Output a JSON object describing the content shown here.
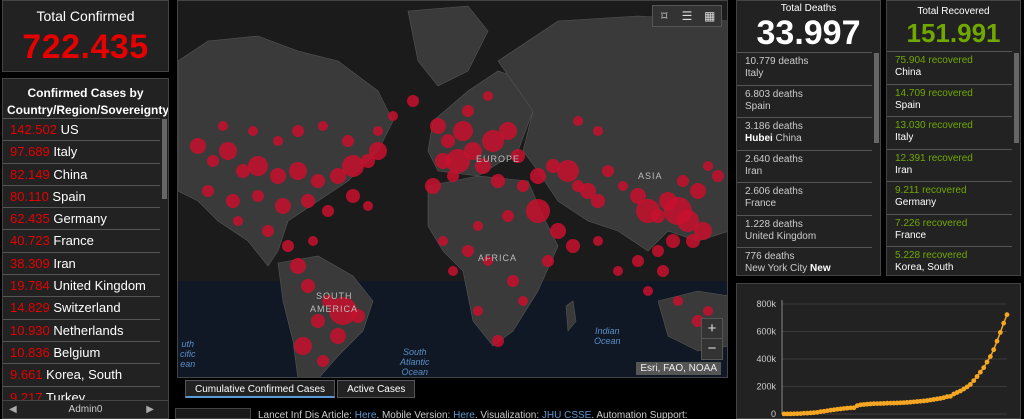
{
  "total_confirmed": {
    "title": "Total Confirmed",
    "value": "722.435"
  },
  "country_list": {
    "header": "Confirmed Cases by Country/Region/Sovereignty",
    "items": [
      {
        "value": "142.502",
        "name": "US"
      },
      {
        "value": "97.689",
        "name": "Italy"
      },
      {
        "value": "82.149",
        "name": "China"
      },
      {
        "value": "80.110",
        "name": "Spain"
      },
      {
        "value": "62.435",
        "name": "Germany"
      },
      {
        "value": "40.723",
        "name": "France"
      },
      {
        "value": "38.309",
        "name": "Iran"
      },
      {
        "value": "19.784",
        "name": "United Kingdom"
      },
      {
        "value": "14.829",
        "name": "Switzerland"
      },
      {
        "value": "10.930",
        "name": "Netherlands"
      },
      {
        "value": "10.836",
        "name": "Belgium"
      },
      {
        "value": "9.661",
        "name": "Korea, South"
      },
      {
        "value": "9.217",
        "name": "Turkey"
      }
    ],
    "footer": "Admin0"
  },
  "map": {
    "labels": {
      "europe": "EUROPE",
      "asia": "ASIA",
      "africa": "AFRICA",
      "south_america_1": "SOUTH",
      "south_america_2": "AMERICA"
    },
    "oceans": {
      "south_pacific_1": "uth",
      "south_pacific_2": "cific",
      "south_pacific_3": "ean",
      "south_atlantic_1": "South",
      "south_atlantic_2": "Atlantic",
      "south_atlantic_3": "Ocean",
      "indian_1": "Indian",
      "indian_2": "Ocean"
    },
    "attribution": "Esri, FAO, NOAA",
    "zoom_in": "+",
    "zoom_out": "−",
    "icons": [
      "bookmark-icon",
      "list-icon",
      "qr-code-icon"
    ]
  },
  "tabs": [
    {
      "label": "Cumulative Confirmed Cases",
      "active": true
    },
    {
      "label": "Active Cases",
      "active": false
    }
  ],
  "bottom_strip": {
    "text1": "Lancet Inf Dis Article: ",
    "link1": "Here",
    "text2": ". Mobile Version: ",
    "link2": "Here",
    "text3": ". Visualization: ",
    "link3": "JHU CSSE",
    "text4": ". Automation Support: "
  },
  "total_deaths": {
    "title": "Total Deaths",
    "value": "33.997",
    "items": [
      {
        "count": "10.779 deaths",
        "place_bold": "",
        "place": "Italy",
        "new": ""
      },
      {
        "count": "6.803 deaths",
        "place_bold": "",
        "place": "Spain",
        "new": ""
      },
      {
        "count": "3.186 deaths",
        "place_bold": "Hubei",
        "place": " China",
        "new": ""
      },
      {
        "count": "2.640 deaths",
        "place_bold": "",
        "place": "Iran",
        "new": ""
      },
      {
        "count": "2.606 deaths",
        "place_bold": "",
        "place": "France",
        "new": ""
      },
      {
        "count": "1.228 deaths",
        "place_bold": "",
        "place": "United Kingdom",
        "new": ""
      },
      {
        "count": "776 deaths",
        "place_bold": "",
        "place": "New York City ",
        "new": "New"
      }
    ]
  },
  "total_recovered": {
    "title": "Total Recovered",
    "value": "151.991",
    "items": [
      {
        "count": "75.904",
        "label": " recovered",
        "place": "China"
      },
      {
        "count": "14.709",
        "label": " recovered",
        "place": "Spain"
      },
      {
        "count": "13.030",
        "label": " recovered",
        "place": "Italy"
      },
      {
        "count": "12.391",
        "label": " recovered",
        "place": "Iran"
      },
      {
        "count": "9.211",
        "label": " recovered",
        "place": "Germany"
      },
      {
        "count": "7.226",
        "label": " recovered",
        "place": "France"
      },
      {
        "count": "5.228",
        "label": " recovered",
        "place": "Korea, South"
      }
    ]
  },
  "colors": {
    "confirmed": "#e60000",
    "recovered": "#70a800",
    "chart_line": "#f5a623"
  },
  "chart_data": {
    "type": "line",
    "ylim": [
      0,
      800000
    ],
    "yticks": [
      "0",
      "200k",
      "400k",
      "600k",
      "800k"
    ],
    "series": [
      {
        "values": [
          555,
          653,
          941,
          1438,
          2118,
          2927,
          5578,
          6166,
          8234,
          9927,
          12038,
          16787,
          19881,
          23892,
          27635,
          30817,
          34391,
          37120,
          40150,
          42762,
          44802,
          45221,
          60368,
          66885,
          69030,
          71224,
          73258,
          75136,
          75639,
          76197,
          76819,
          78572,
          78958,
          79561,
          80406,
          81388,
          82746,
          84112,
          86011,
          88369,
          90306,
          92840,
          95120,
          97886,
          101800,
          105847,
          109821,
          113590,
          118620,
          125875,
          128352,
          145205,
          156101,
          167454,
          181574,
          197102,
          214821,
          242570,
          272208,
          304507,
          336953,
          378235,
          418045,
          467653,
          529591,
          593291,
          660706,
          722435
        ]
      }
    ]
  }
}
